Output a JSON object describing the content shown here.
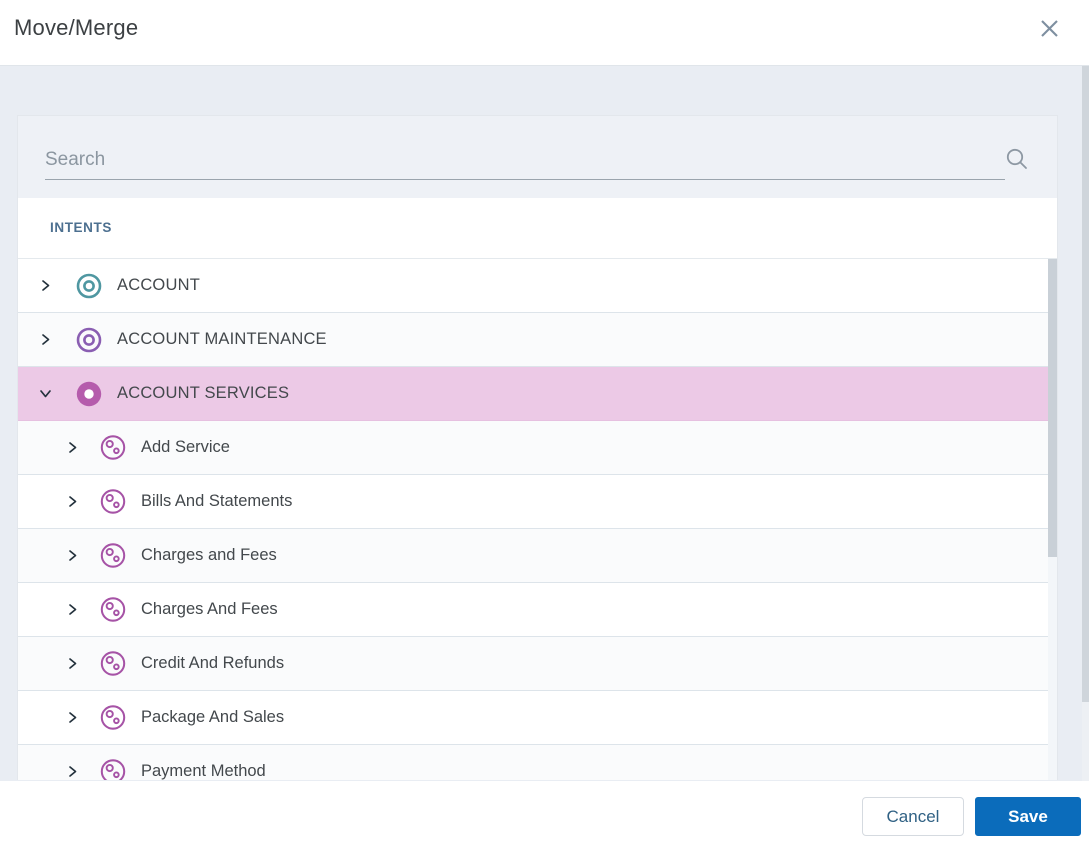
{
  "dialog": {
    "title": "Move/Merge"
  },
  "search": {
    "placeholder": "Search",
    "value": ""
  },
  "tree": {
    "section_header": "INTENTS",
    "items": [
      {
        "label": "ACCOUNT",
        "level": 0,
        "expanded": false,
        "selected": false,
        "icon": "bullseye-outline",
        "icon_color": "#4f97a1"
      },
      {
        "label": "ACCOUNT MAINTENANCE",
        "level": 0,
        "expanded": false,
        "selected": false,
        "icon": "bullseye-outline",
        "icon_color": "#8a5eb2"
      },
      {
        "label": "ACCOUNT SERVICES",
        "level": 0,
        "expanded": true,
        "selected": true,
        "icon": "donut-filled",
        "icon_color": "#b55cac"
      },
      {
        "label": "Add Service",
        "level": 1,
        "expanded": false,
        "selected": false,
        "icon": "molecule-outline",
        "icon_color": "#a653a6"
      },
      {
        "label": "Bills And Statements",
        "level": 1,
        "expanded": false,
        "selected": false,
        "icon": "molecule-outline",
        "icon_color": "#a653a6"
      },
      {
        "label": "Charges and Fees",
        "level": 1,
        "expanded": false,
        "selected": false,
        "icon": "molecule-outline",
        "icon_color": "#a653a6"
      },
      {
        "label": "Charges And Fees",
        "level": 1,
        "expanded": false,
        "selected": false,
        "icon": "molecule-outline",
        "icon_color": "#a653a6"
      },
      {
        "label": "Credit And Refunds",
        "level": 1,
        "expanded": false,
        "selected": false,
        "icon": "molecule-outline",
        "icon_color": "#a653a6"
      },
      {
        "label": "Package And Sales",
        "level": 1,
        "expanded": false,
        "selected": false,
        "icon": "molecule-outline",
        "icon_color": "#a653a6"
      },
      {
        "label": "Payment Method",
        "level": 1,
        "expanded": false,
        "selected": false,
        "icon": "molecule-outline",
        "icon_color": "#a653a6"
      }
    ]
  },
  "footer": {
    "cancel_label": "Cancel",
    "save_label": "Save"
  },
  "icons": {
    "close-icon": "x-cross",
    "search-icon": "magnifying-glass",
    "chevron-right-icon": "collapsed-arrow",
    "chevron-down-icon": "expanded-arrow",
    "intent-icon": "bullseye-circle",
    "subintent-icon": "circle-with-two-dots"
  },
  "colors": {
    "selected_row_bg": "#ecc9e6",
    "save_button_bg": "#0b6cbb",
    "cancel_text": "#306184",
    "section_header_text": "#4d7090",
    "body_band_bg": "#e9edf3",
    "intent_teal": "#4f97a1",
    "intent_purple": "#8a5eb2",
    "intent_magenta": "#b55cac",
    "subintent_orchid": "#a653a6"
  }
}
